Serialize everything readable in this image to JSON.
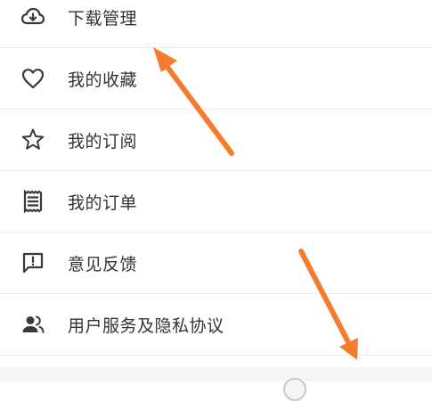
{
  "menu": {
    "items": [
      {
        "label": "下载管理",
        "icon": "cloud-download-icon"
      },
      {
        "label": "我的收藏",
        "icon": "heart-icon"
      },
      {
        "label": "我的订阅",
        "icon": "star-icon"
      },
      {
        "label": "我的订单",
        "icon": "receipt-icon"
      },
      {
        "label": "意见反馈",
        "icon": "feedback-icon"
      },
      {
        "label": "用户服务及隐私协议",
        "icon": "people-icon"
      }
    ]
  },
  "annotations": {
    "arrow_color": "#f47c2f"
  },
  "colors": {
    "text": "#333333",
    "icon": "#3a3a3a",
    "divider": "#ececec"
  }
}
